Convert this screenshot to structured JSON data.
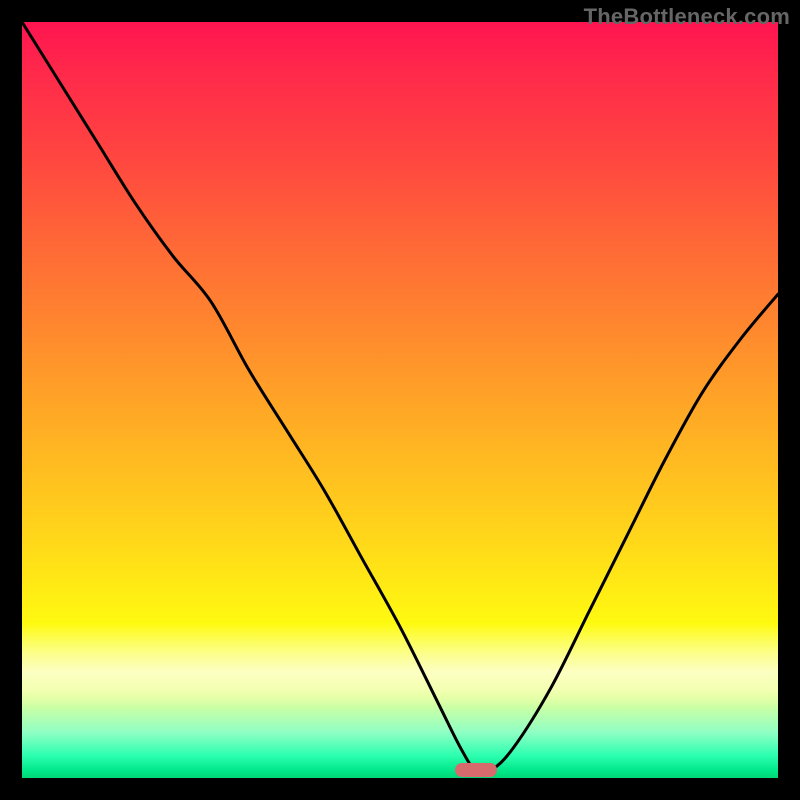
{
  "watermark": "TheBottleneck.com",
  "chart_data": {
    "type": "line",
    "title": "",
    "xlabel": "",
    "ylabel": "",
    "xlim": [
      0,
      100
    ],
    "ylim": [
      0,
      100
    ],
    "grid": false,
    "series": [
      {
        "name": "bottleneck-curve",
        "x": [
          0,
          5,
          10,
          15,
          20,
          25,
          30,
          35,
          40,
          45,
          50,
          55,
          58,
          60,
          62,
          65,
          70,
          75,
          80,
          85,
          90,
          95,
          100
        ],
        "y": [
          100,
          92,
          84,
          76,
          69,
          63,
          54,
          46,
          38,
          29,
          20,
          10,
          4,
          1,
          1,
          4,
          12,
          22,
          32,
          42,
          51,
          58,
          64
        ]
      }
    ],
    "marker": {
      "x": 60,
      "y": 1,
      "color": "#d66a6c"
    },
    "background_gradient_note": "vertical red→orange→yellow→green"
  }
}
